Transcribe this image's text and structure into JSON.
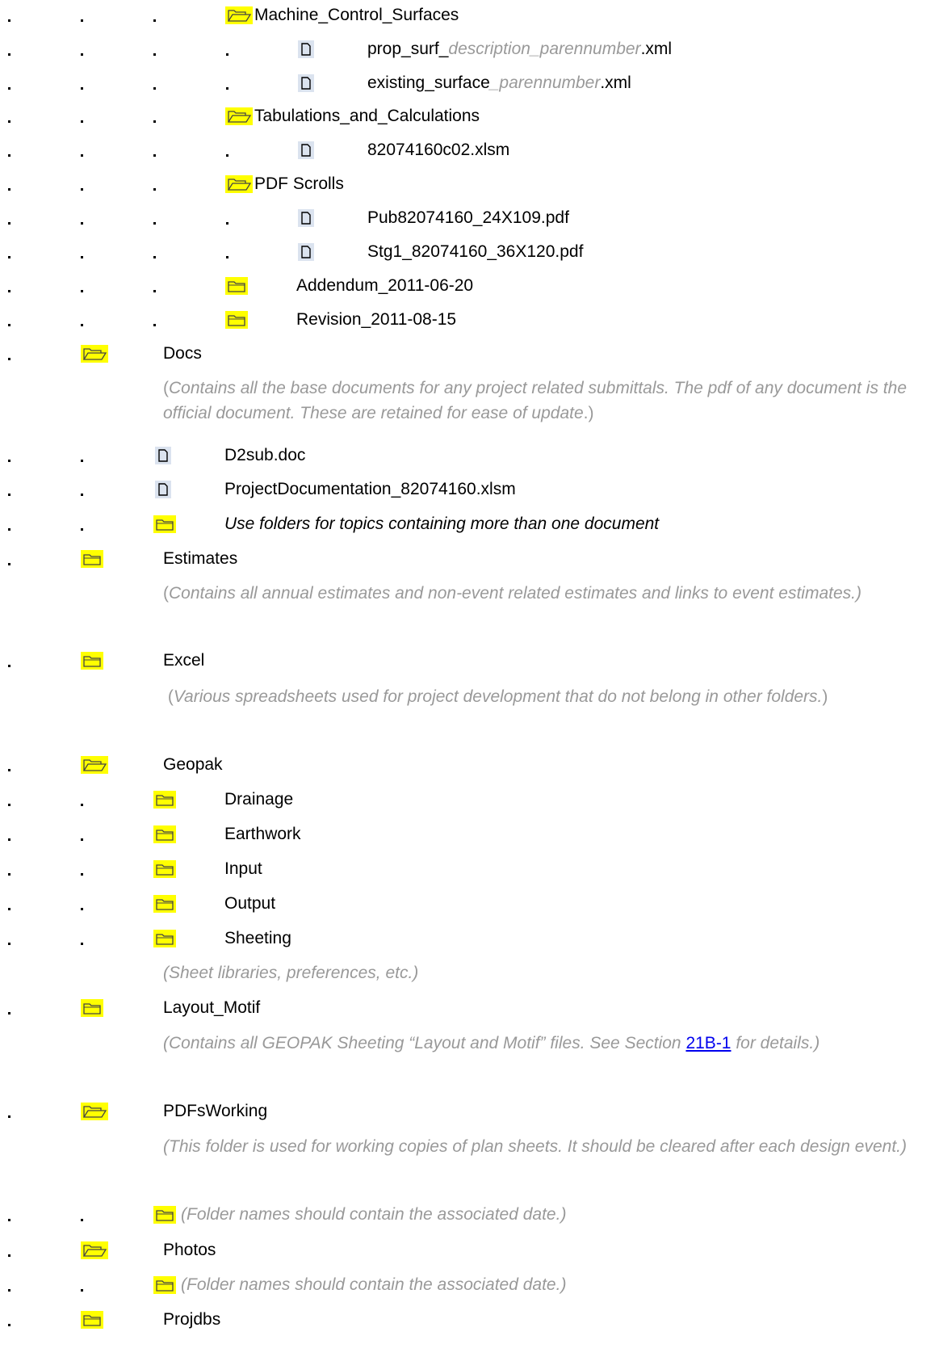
{
  "icons": {
    "folder_open": "open-folder-icon",
    "folder_closed": "closed-folder-icon",
    "file": "file-icon"
  },
  "colors": {
    "folder_highlight": "#ffff00",
    "note_text": "#999999",
    "link": "#0000ee"
  },
  "tree": {
    "machine_control_surfaces": "Machine_Control_Surfaces",
    "prop_surf_prefix": "prop_surf_",
    "prop_surf_var": "description_parennumber",
    "prop_surf_ext": ".xml",
    "existing_surface_prefix": "existing_surface",
    "existing_surface_var": "_parennumber",
    "existing_surface_ext": ".xml",
    "tabulations": "Tabulations_and_Calculations",
    "xlsm_file": "82074160c02.xlsm",
    "pdf_scrolls": "PDF Scrolls",
    "pub_pdf": "Pub82074160_24X109.pdf",
    "stg_pdf": "Stg1_82074160_36X120.pdf",
    "addendum": "Addendum_2011-06-20",
    "revision": "Revision_2011-08-15",
    "docs": "Docs",
    "docs_note": "Contains all the base documents for any project related submittals.  The pdf of any document is the official document.  These are retained for ease of update",
    "d2sub": "D2sub.doc",
    "project_doc": "ProjectDocumentation_82074160.xlsm",
    "topics_note": "Use folders for topics containing more than one document",
    "estimates": "Estimates",
    "estimates_note": "Contains all annual estimates and non-event related estimates and links to event estimates.)",
    "excel": "Excel",
    "excel_note": "Various spreadsheets used for project development that do not belong in other folders.",
    "geopak": "Geopak",
    "drainage": "Drainage",
    "earthwork": "Earthwork",
    "input": "Input",
    "output": "Output",
    "sheeting": "Sheeting",
    "sheeting_note": "(Sheet libraries, preferences, etc.)",
    "layout_motif": "Layout_Motif",
    "layout_note_before": "(Contains all GEOPAK Sheeting “Layout and Motif” files.  See Section ",
    "layout_link": "21B-1",
    "layout_note_after": " for details.)",
    "pdfs_working": "PDFsWorking",
    "pdfs_working_note": "(This folder is used for working copies of plan sheets.  It should be cleared after each design event.)",
    "date_note": "(Folder names should contain the associated date.)",
    "photos": "Photos",
    "projdbs": "Projdbs"
  }
}
